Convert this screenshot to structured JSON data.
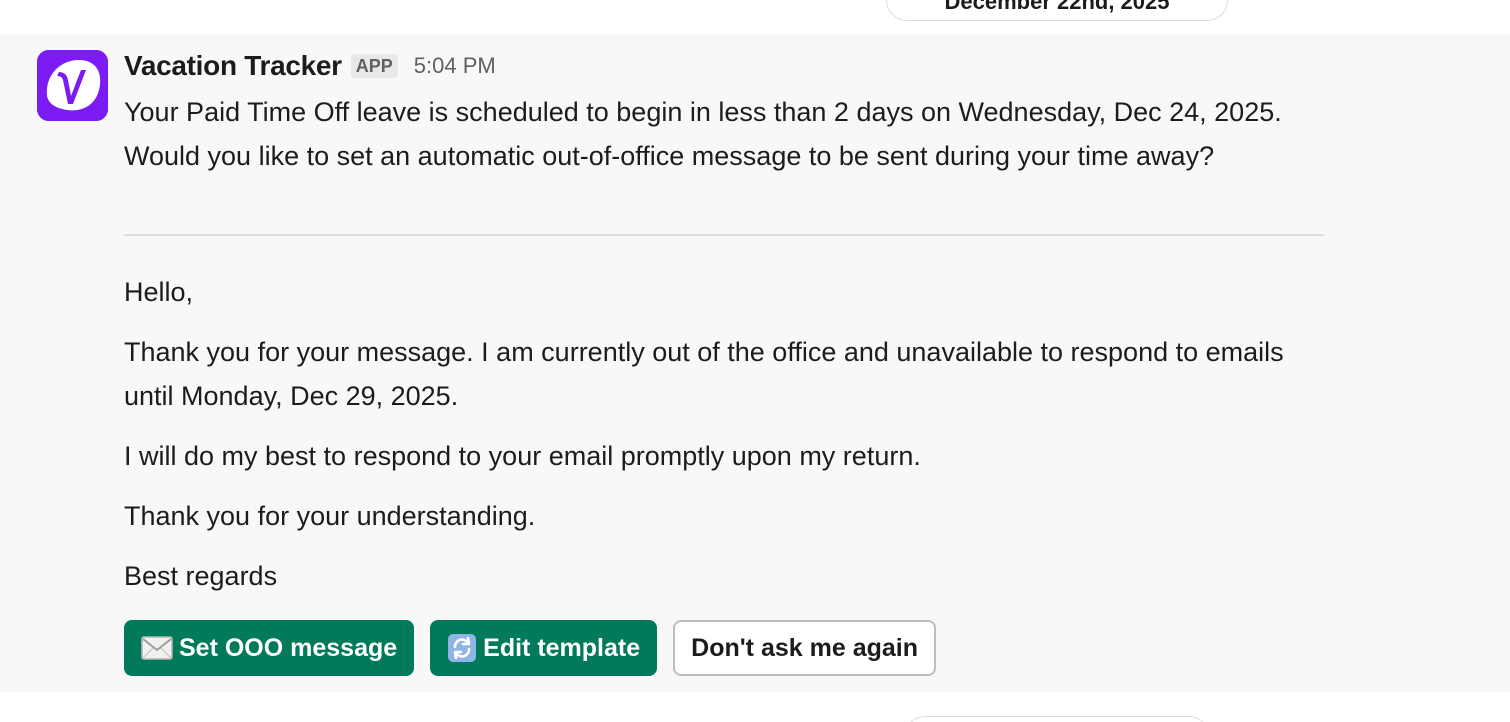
{
  "date_dividers": {
    "top": "December 22nd, 2025"
  },
  "message": {
    "sender": "Vacation Tracker",
    "badge": "APP",
    "time": "5:04 PM",
    "avatar_letter": "V",
    "intro": "Your Paid Time Off leave is scheduled to begin in less than 2 days on Wednesday, Dec 24, 2025. Would you like to set an automatic out-of-office message to be sent during your time away?",
    "template": {
      "greeting": "Hello,",
      "paragraph1": "Thank you for your message. I am currently out of the office and unavailable to respond to emails until Monday, Dec 29, 2025.",
      "paragraph2": "I will do my best to respond to your email promptly upon my return.",
      "paragraph3": "Thank you for your understanding.",
      "signoff": "Best regards"
    },
    "buttons": {
      "set_ooo": "Set OOO message",
      "edit_template": "Edit template",
      "dont_ask": "Don't ask me again"
    }
  },
  "icons": {
    "set_ooo": "envelope-icon",
    "edit_template": "refresh-arrows-icon"
  },
  "colors": {
    "avatar_bg": "#7d1bf5",
    "primary_button": "#007a5a",
    "message_bg": "#f8f8f8"
  }
}
